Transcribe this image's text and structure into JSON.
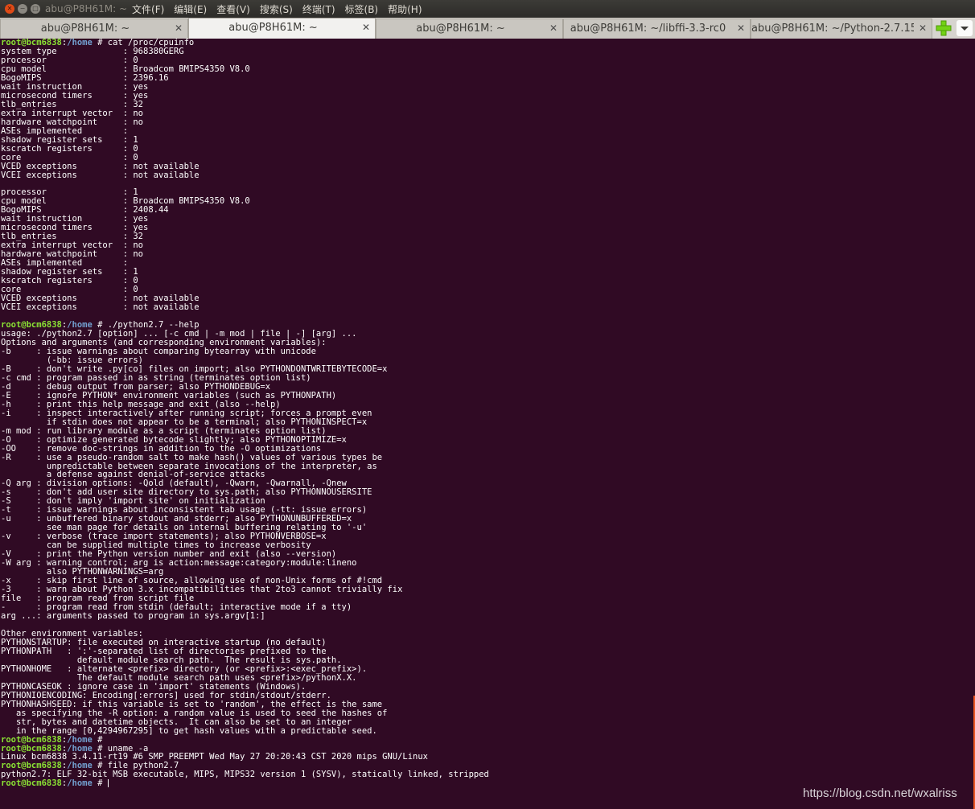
{
  "window": {
    "title": "abu@P8H61M: ~",
    "menu": [
      "文件(F)",
      "编辑(E)",
      "查看(V)",
      "搜索(S)",
      "终端(T)",
      "标签(B)",
      "帮助(H)"
    ],
    "close_glyph": "✕",
    "min_glyph": "−",
    "max_glyph": "□"
  },
  "tabs": [
    {
      "label": "abu@P8H61M: ~",
      "active": false
    },
    {
      "label": "abu@P8H61M: ~",
      "active": true
    },
    {
      "label": "abu@P8H61M: ~",
      "active": false
    },
    {
      "label": "abu@P8H61M: ~/libffi-3.3-rc0",
      "active": false
    },
    {
      "label": "abu@P8H61M: ~/Python-2.7.15",
      "active": false
    }
  ],
  "tab_close_glyph": "✕",
  "icons": {
    "new_tab": "plus-icon",
    "tab_menu": "chevron-down-icon"
  },
  "colors": {
    "terminal_bg": "#300a24",
    "prompt_user": "#8ae234",
    "prompt_path": "#729fcf",
    "text": "#ffffff",
    "new_tab_icon": "#73d216",
    "scroll_accent": "#e95420"
  },
  "prompt": {
    "user": "root@bcm6838",
    "sep": ":",
    "path": "/home",
    "sym": " # "
  },
  "terminal_lines": [
    {
      "type": "prompt",
      "cmd": "cat /proc/cpuinfo"
    },
    {
      "type": "text",
      "text": "system type             : 968380GERG"
    },
    {
      "type": "text",
      "text": "processor               : 0"
    },
    {
      "type": "text",
      "text": "cpu model               : Broadcom BMIPS4350 V8.0"
    },
    {
      "type": "text",
      "text": "BogoMIPS                : 2396.16"
    },
    {
      "type": "text",
      "text": "wait instruction        : yes"
    },
    {
      "type": "text",
      "text": "microsecond timers      : yes"
    },
    {
      "type": "text",
      "text": "tlb_entries             : 32"
    },
    {
      "type": "text",
      "text": "extra interrupt vector  : no"
    },
    {
      "type": "text",
      "text": "hardware watchpoint     : no"
    },
    {
      "type": "text",
      "text": "ASEs implemented        :"
    },
    {
      "type": "text",
      "text": "shadow register sets    : 1"
    },
    {
      "type": "text",
      "text": "kscratch registers      : 0"
    },
    {
      "type": "text",
      "text": "core                    : 0"
    },
    {
      "type": "text",
      "text": "VCED exceptions         : not available"
    },
    {
      "type": "text",
      "text": "VCEI exceptions         : not available"
    },
    {
      "type": "text",
      "text": ""
    },
    {
      "type": "text",
      "text": "processor               : 1"
    },
    {
      "type": "text",
      "text": "cpu model               : Broadcom BMIPS4350 V8.0"
    },
    {
      "type": "text",
      "text": "BogoMIPS                : 2408.44"
    },
    {
      "type": "text",
      "text": "wait instruction        : yes"
    },
    {
      "type": "text",
      "text": "microsecond timers      : yes"
    },
    {
      "type": "text",
      "text": "tlb_entries             : 32"
    },
    {
      "type": "text",
      "text": "extra interrupt vector  : no"
    },
    {
      "type": "text",
      "text": "hardware watchpoint     : no"
    },
    {
      "type": "text",
      "text": "ASEs implemented        :"
    },
    {
      "type": "text",
      "text": "shadow register sets    : 1"
    },
    {
      "type": "text",
      "text": "kscratch registers      : 0"
    },
    {
      "type": "text",
      "text": "core                    : 0"
    },
    {
      "type": "text",
      "text": "VCED exceptions         : not available"
    },
    {
      "type": "text",
      "text": "VCEI exceptions         : not available"
    },
    {
      "type": "text",
      "text": ""
    },
    {
      "type": "prompt",
      "cmd": "./python2.7 --help"
    },
    {
      "type": "text",
      "text": "usage: ./python2.7 [option] ... [-c cmd | -m mod | file | -] [arg] ..."
    },
    {
      "type": "text",
      "text": "Options and arguments (and corresponding environment variables):"
    },
    {
      "type": "text",
      "text": "-b     : issue warnings about comparing bytearray with unicode"
    },
    {
      "type": "text",
      "text": "         (-bb: issue errors)"
    },
    {
      "type": "text",
      "text": "-B     : don't write .py[co] files on import; also PYTHONDONTWRITEBYTECODE=x"
    },
    {
      "type": "text",
      "text": "-c cmd : program passed in as string (terminates option list)"
    },
    {
      "type": "text",
      "text": "-d     : debug output from parser; also PYTHONDEBUG=x"
    },
    {
      "type": "text",
      "text": "-E     : ignore PYTHON* environment variables (such as PYTHONPATH)"
    },
    {
      "type": "text",
      "text": "-h     : print this help message and exit (also --help)"
    },
    {
      "type": "text",
      "text": "-i     : inspect interactively after running script; forces a prompt even"
    },
    {
      "type": "text",
      "text": "         if stdin does not appear to be a terminal; also PYTHONINSPECT=x"
    },
    {
      "type": "text",
      "text": "-m mod : run library module as a script (terminates option list)"
    },
    {
      "type": "text",
      "text": "-O     : optimize generated bytecode slightly; also PYTHONOPTIMIZE=x"
    },
    {
      "type": "text",
      "text": "-OO    : remove doc-strings in addition to the -O optimizations"
    },
    {
      "type": "text",
      "text": "-R     : use a pseudo-random salt to make hash() values of various types be"
    },
    {
      "type": "text",
      "text": "         unpredictable between separate invocations of the interpreter, as"
    },
    {
      "type": "text",
      "text": "         a defense against denial-of-service attacks"
    },
    {
      "type": "text",
      "text": "-Q arg : division options: -Qold (default), -Qwarn, -Qwarnall, -Qnew"
    },
    {
      "type": "text",
      "text": "-s     : don't add user site directory to sys.path; also PYTHONNOUSERSITE"
    },
    {
      "type": "text",
      "text": "-S     : don't imply 'import site' on initialization"
    },
    {
      "type": "text",
      "text": "-t     : issue warnings about inconsistent tab usage (-tt: issue errors)"
    },
    {
      "type": "text",
      "text": "-u     : unbuffered binary stdout and stderr; also PYTHONUNBUFFERED=x"
    },
    {
      "type": "text",
      "text": "         see man page for details on internal buffering relating to '-u'"
    },
    {
      "type": "text",
      "text": "-v     : verbose (trace import statements); also PYTHONVERBOSE=x"
    },
    {
      "type": "text",
      "text": "         can be supplied multiple times to increase verbosity"
    },
    {
      "type": "text",
      "text": "-V     : print the Python version number and exit (also --version)"
    },
    {
      "type": "text",
      "text": "-W arg : warning control; arg is action:message:category:module:lineno"
    },
    {
      "type": "text",
      "text": "         also PYTHONWARNINGS=arg"
    },
    {
      "type": "text",
      "text": "-x     : skip first line of source, allowing use of non-Unix forms of #!cmd"
    },
    {
      "type": "text",
      "text": "-3     : warn about Python 3.x incompatibilities that 2to3 cannot trivially fix"
    },
    {
      "type": "text",
      "text": "file   : program read from script file"
    },
    {
      "type": "text",
      "text": "-      : program read from stdin (default; interactive mode if a tty)"
    },
    {
      "type": "text",
      "text": "arg ...: arguments passed to program in sys.argv[1:]"
    },
    {
      "type": "text",
      "text": ""
    },
    {
      "type": "text",
      "text": "Other environment variables:"
    },
    {
      "type": "text",
      "text": "PYTHONSTARTUP: file executed on interactive startup (no default)"
    },
    {
      "type": "text",
      "text": "PYTHONPATH   : ':'-separated list of directories prefixed to the"
    },
    {
      "type": "text",
      "text": "               default module search path.  The result is sys.path."
    },
    {
      "type": "text",
      "text": "PYTHONHOME   : alternate <prefix> directory (or <prefix>:<exec_prefix>)."
    },
    {
      "type": "text",
      "text": "               The default module search path uses <prefix>/pythonX.X."
    },
    {
      "type": "text",
      "text": "PYTHONCASEOK : ignore case in 'import' statements (Windows)."
    },
    {
      "type": "text",
      "text": "PYTHONIOENCODING: Encoding[:errors] used for stdin/stdout/stderr."
    },
    {
      "type": "text",
      "text": "PYTHONHASHSEED: if this variable is set to 'random', the effect is the same"
    },
    {
      "type": "text",
      "text": "   as specifying the -R option: a random value is used to seed the hashes of"
    },
    {
      "type": "text",
      "text": "   str, bytes and datetime objects.  It can also be set to an integer"
    },
    {
      "type": "text",
      "text": "   in the range [0,4294967295] to get hash values with a predictable seed."
    },
    {
      "type": "prompt",
      "cmd": ""
    },
    {
      "type": "prompt",
      "cmd": "uname -a"
    },
    {
      "type": "text",
      "text": "Linux bcm6838 3.4.11-rt19 #6 SMP PREEMPT Wed May 27 20:20:43 CST 2020 mips GNU/Linux"
    },
    {
      "type": "prompt",
      "cmd": "file python2.7"
    },
    {
      "type": "text",
      "text": "python2.7: ELF 32-bit MSB executable, MIPS, MIPS32 version 1 (SYSV), statically linked, stripped"
    },
    {
      "type": "prompt",
      "cmd": "",
      "cursor": true
    }
  ],
  "watermark": "https://blog.csdn.net/wxalriss"
}
